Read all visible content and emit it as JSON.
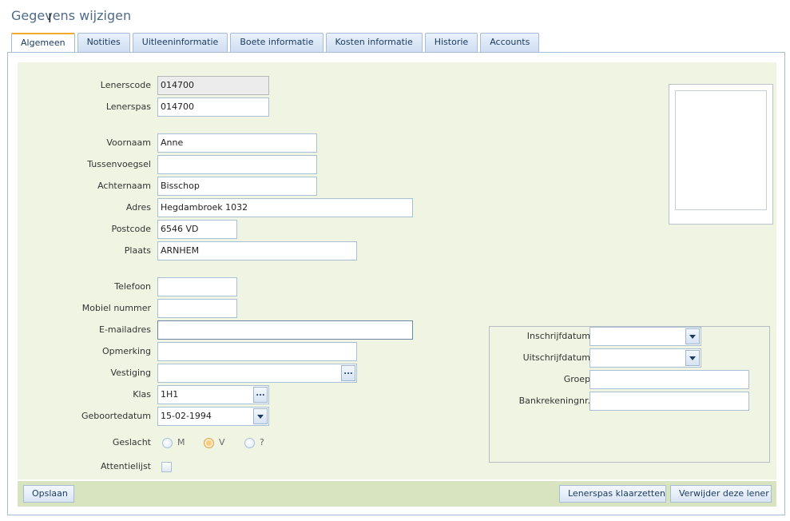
{
  "page": {
    "title": "Gegevens wijzigen"
  },
  "tabs": [
    "Algemeen",
    "Notities",
    "Uitleeninformatie",
    "Boete informatie",
    "Kosten informatie",
    "Historie",
    "Accounts"
  ],
  "form": {
    "lenerscode": {
      "label": "Lenerscode",
      "value": "014700"
    },
    "lenerspas": {
      "label": "Lenerspas",
      "value": "014700"
    },
    "voornaam": {
      "label": "Voornaam",
      "value": "Anne"
    },
    "tussenvoegsel": {
      "label": "Tussenvoegsel",
      "value": ""
    },
    "achternaam": {
      "label": "Achternaam",
      "value": "Bisschop"
    },
    "adres": {
      "label": "Adres",
      "value": "Hegdambroek 1032"
    },
    "postcode": {
      "label": "Postcode",
      "value": "6546 VD"
    },
    "plaats": {
      "label": "Plaats",
      "value": "ARNHEM"
    },
    "telefoon": {
      "label": "Telefoon",
      "value": ""
    },
    "mobiel": {
      "label": "Mobiel nummer",
      "value": ""
    },
    "email": {
      "label": "E-mailadres",
      "value": ""
    },
    "opmerking": {
      "label": "Opmerking",
      "value": ""
    },
    "vestiging": {
      "label": "Vestiging",
      "value": ""
    },
    "klas": {
      "label": "Klas",
      "value": "1H1"
    },
    "geboortedatum": {
      "label": "Geboortedatum",
      "value": "15-02-1994"
    },
    "geslacht": {
      "label": "Geslacht",
      "options": [
        "M",
        "V",
        "?"
      ],
      "selected": "V"
    },
    "attentielijst": {
      "label": "Attentielijst",
      "checked": false
    }
  },
  "right_group": {
    "inschrijfdatum": {
      "label": "Inschrijfdatum",
      "value": ""
    },
    "uitschrijfdatum": {
      "label": "Uitschrijfdatum",
      "value": ""
    },
    "groep": {
      "label": "Groep",
      "value": ""
    },
    "bankrekening": {
      "label": "Bankrekeningnr.",
      "value": ""
    }
  },
  "buttons": {
    "save": "Opslaan",
    "reset_pass": "Lenerspas klaarzetten",
    "delete": "Verwijder deze lener"
  },
  "icons": {
    "picker": "ellipsis-icon",
    "dropdown": "chevron-down-icon"
  },
  "colors": {
    "accent": "#f0a830",
    "form_bg": "#f0f5e3",
    "button_bar": "#d8e3bf",
    "tab_text": "#1c3b62"
  }
}
